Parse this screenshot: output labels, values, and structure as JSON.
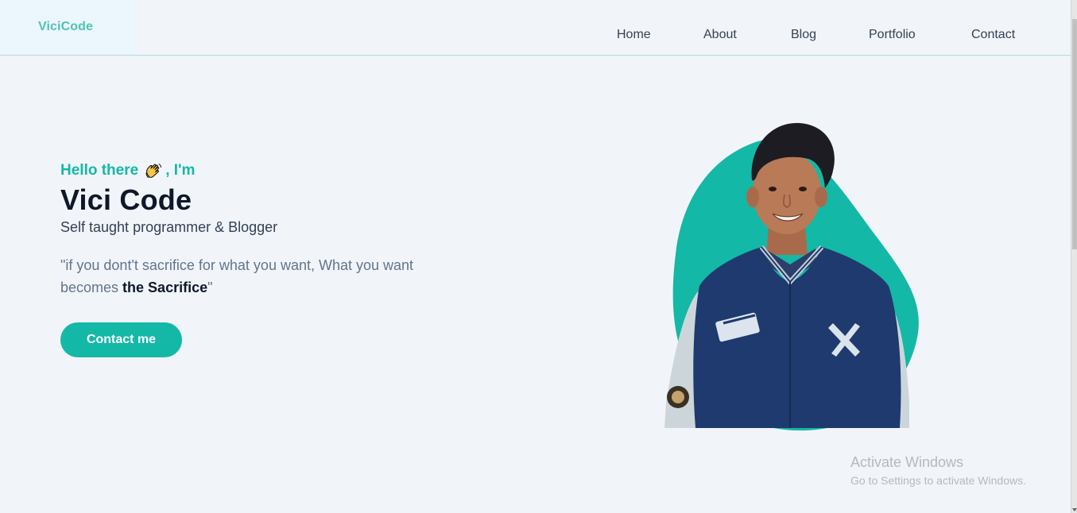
{
  "brand": "ViciCode",
  "nav": {
    "items": [
      {
        "label": "Home"
      },
      {
        "label": "About"
      },
      {
        "label": "Blog"
      },
      {
        "label": "Portfolio"
      },
      {
        "label": "Contact"
      }
    ]
  },
  "hero": {
    "greeting_pre": "Hello there",
    "greeting_icon": "waving-hand-emoji",
    "greeting_post": ", I'm",
    "name": "Vici Code",
    "subtitle": "Self taught programmer & Blogger",
    "quote_open": "\"if you dont't sacrifice for what you want, What you want becomes ",
    "quote_bold": "the Sacrifice",
    "quote_close": "\"",
    "cta_label": "Contact me",
    "photo_icon": "profile-photo"
  },
  "watermark": {
    "title": "Activate Windows",
    "subtitle": "Go to Settings to activate Windows."
  },
  "colors": {
    "accent": "#14b8a6",
    "brand": "#4fc3b3",
    "background": "#f1f5f9",
    "heading": "#0f172a",
    "jacket": "#1e3a6e"
  }
}
